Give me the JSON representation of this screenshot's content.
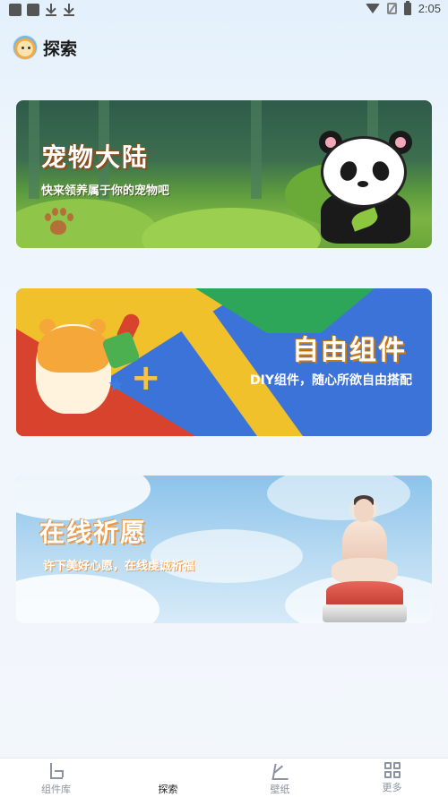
{
  "status_bar": {
    "time": "2:05"
  },
  "header": {
    "title": "探索",
    "logo_icon": "hamster-logo-icon"
  },
  "cards": [
    {
      "title": "宠物大陆",
      "subtitle": "快来领养属于你的宠物吧",
      "theme_color": "#5b9a3e"
    },
    {
      "title": "自由组件",
      "subtitle": "DIY组件，随心所欲自由搭配",
      "theme_color": "#3c73d8"
    },
    {
      "title": "在线祈愿",
      "subtitle": "许下美好心愿，在线虔诚祈福",
      "theme_color": "#8cc3ea"
    }
  ],
  "bottom_nav": [
    {
      "label": "组件库",
      "icon": "widget-library-icon",
      "active": false
    },
    {
      "label": "探索",
      "icon": "explore-icon",
      "active": true
    },
    {
      "label": "壁纸",
      "icon": "wallpaper-icon",
      "active": false
    },
    {
      "label": "更多",
      "icon": "grid-more-icon",
      "active": false
    }
  ],
  "colors": {
    "background": "#eef5fc",
    "nav_active": "#222222",
    "nav_inactive": "#8a93a0"
  }
}
